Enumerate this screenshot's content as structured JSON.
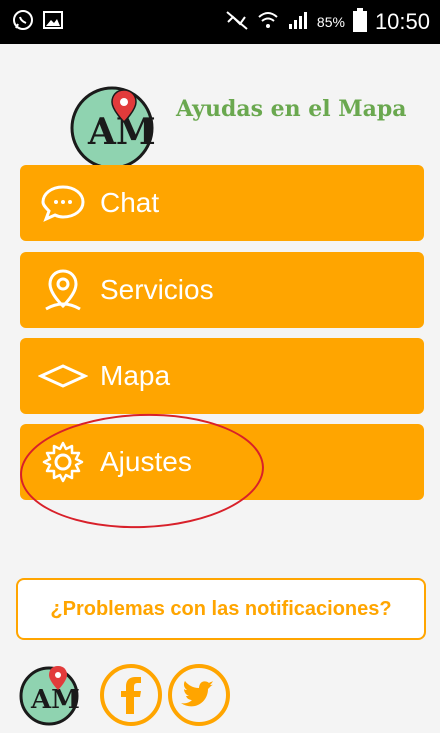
{
  "status_bar": {
    "battery_percent": "85%",
    "time": "10:50",
    "icons": [
      "whatsapp-icon",
      "image-icon",
      "mute-icon",
      "wifi-icon",
      "signal-icon",
      "battery-icon"
    ]
  },
  "header": {
    "logo_text": "AM",
    "title": "Ayudas en el Mapa"
  },
  "menu": {
    "items": [
      {
        "label": "Chat",
        "icon": "chat-bubble-icon"
      },
      {
        "label": "Servicios",
        "icon": "location-pin-icon"
      },
      {
        "label": "Mapa",
        "icon": "map-diamond-icon"
      },
      {
        "label": "Ajustes",
        "icon": "gear-icon"
      }
    ]
  },
  "problems_button": {
    "label": "¿Problemas con las notificaciones?"
  },
  "footer": {
    "icons": [
      "app-logo-icon",
      "facebook-icon",
      "twitter-icon"
    ]
  },
  "colors": {
    "accent": "#ffa500",
    "title_green": "#6aa84f",
    "highlight_red": "#d8202a"
  }
}
